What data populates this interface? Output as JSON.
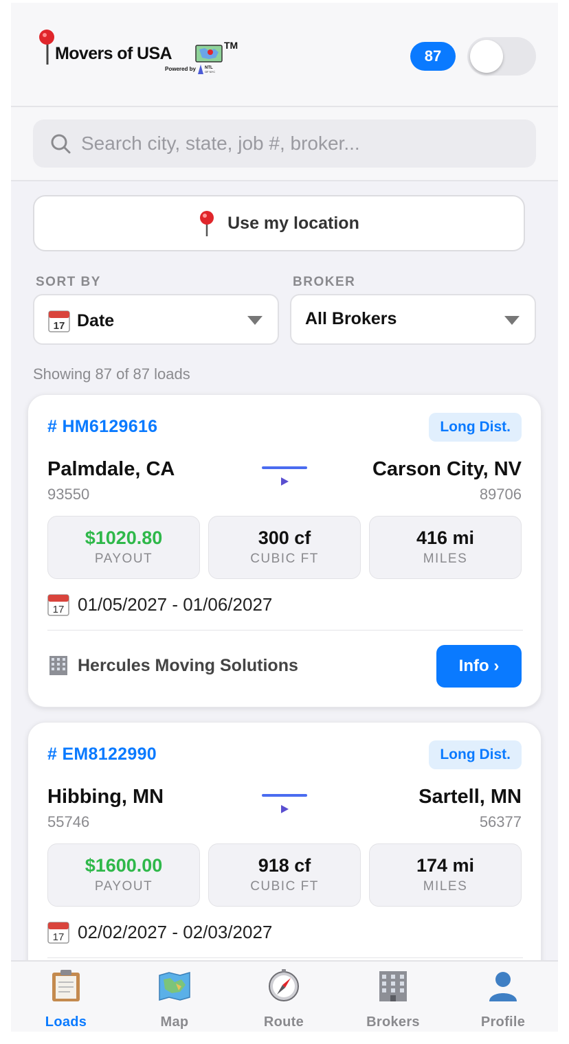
{
  "header": {
    "brand": "Movers of USA",
    "trademark": "TM",
    "powered_by": "Powered by",
    "partner": "NTL OF NYC",
    "load_count": "87"
  },
  "search": {
    "placeholder": "Search city, state, job #, broker..."
  },
  "location_button": {
    "label": "Use my location"
  },
  "filters": {
    "sort_label": "SORT BY",
    "sort_value": "Date",
    "broker_label": "BROKER",
    "broker_value": "All Brokers"
  },
  "showing": "Showing 87 of 87 loads",
  "loads": [
    {
      "job": "# HM6129616",
      "tag": "Long Dist.",
      "from_city": "Palmdale, CA",
      "from_zip": "93550",
      "to_city": "Carson City, NV",
      "to_zip": "89706",
      "payout": "$1020.80",
      "payout_label": "PAYOUT",
      "cubic": "300 cf",
      "cubic_label": "CUBIC FT",
      "miles": "416 mi",
      "miles_label": "MILES",
      "dates": "01/05/2027 - 01/06/2027",
      "broker": "Hercules Moving Solutions",
      "info_label": "Info ›"
    },
    {
      "job": "# EM8122990",
      "tag": "Long Dist.",
      "from_city": "Hibbing, MN",
      "from_zip": "55746",
      "to_city": "Sartell, MN",
      "to_zip": "56377",
      "payout": "$1600.00",
      "payout_label": "PAYOUT",
      "cubic": "918 cf",
      "cubic_label": "CUBIC FT",
      "miles": "174 mi",
      "miles_label": "MILES",
      "dates": "02/02/2027 - 02/03/2027"
    }
  ],
  "tabs": [
    {
      "label": "Loads",
      "icon": "clipboard-icon",
      "active": true
    },
    {
      "label": "Map",
      "icon": "map-icon",
      "active": false
    },
    {
      "label": "Route",
      "icon": "compass-icon",
      "active": false
    },
    {
      "label": "Brokers",
      "icon": "office-building-icon",
      "active": false
    },
    {
      "label": "Profile",
      "icon": "person-silhouette-icon",
      "active": false
    }
  ],
  "colors": {
    "accent": "#0a7aff",
    "payout_green": "#2fb84a",
    "background": "#f2f2f7"
  }
}
